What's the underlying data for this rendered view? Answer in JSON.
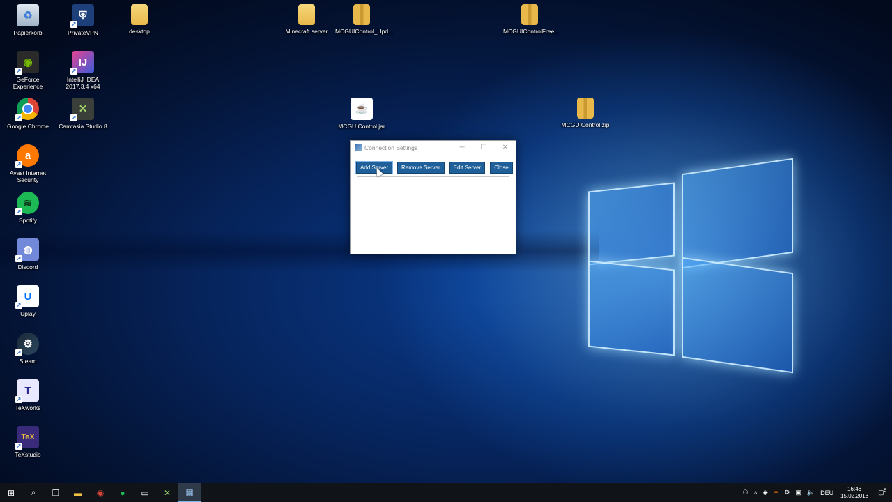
{
  "desktop": {
    "icons": [
      {
        "label": "Papierkorb",
        "icon": "recycle-bin-icon"
      },
      {
        "label": "PrivateVPN",
        "icon": "vpn-shield-icon"
      },
      {
        "label": "desktop",
        "icon": "folder-icon"
      },
      {
        "label": "Minecraft server",
        "icon": "folder-icon"
      },
      {
        "label": "MCGUIControl_Upd...",
        "icon": "zip-folder-icon"
      },
      {
        "label": "MCGUIControlFree...",
        "icon": "zip-folder-icon"
      },
      {
        "label": "GeForce Experience",
        "icon": "geforce-icon"
      },
      {
        "label": "IntelliJ IDEA 2017.3.4 x64",
        "icon": "intellij-icon"
      },
      {
        "label": "Google Chrome",
        "icon": "chrome-icon"
      },
      {
        "label": "Camtasia Studio 8",
        "icon": "camtasia-icon"
      },
      {
        "label": "MCGUIControl.jar",
        "icon": "java-jar-icon"
      },
      {
        "label": "MCGUIControl.zip",
        "icon": "zip-folder-icon"
      },
      {
        "label": "Avast Internet Security",
        "icon": "avast-icon"
      },
      {
        "label": "Spotify",
        "icon": "spotify-icon"
      },
      {
        "label": "Discord",
        "icon": "discord-icon"
      },
      {
        "label": "Uplay",
        "icon": "uplay-icon"
      },
      {
        "label": "Steam",
        "icon": "steam-icon"
      },
      {
        "label": "TeXworks",
        "icon": "texworks-icon"
      },
      {
        "label": "TeXstudio",
        "icon": "texstudio-icon"
      }
    ]
  },
  "dialog": {
    "title": "Connection Settings",
    "buttons": {
      "add": "Add Server",
      "remove": "Remove Server",
      "edit": "Edit Server",
      "close": "Close"
    }
  },
  "taskbar": {
    "tray": {
      "language": "DEU",
      "time": "16:46",
      "date": "15.02.2018",
      "notifications": "5"
    }
  },
  "colors": {
    "button_bg": "#1f5f9a",
    "taskbar_bg": "#101418",
    "active_indicator": "#76b9ed"
  }
}
